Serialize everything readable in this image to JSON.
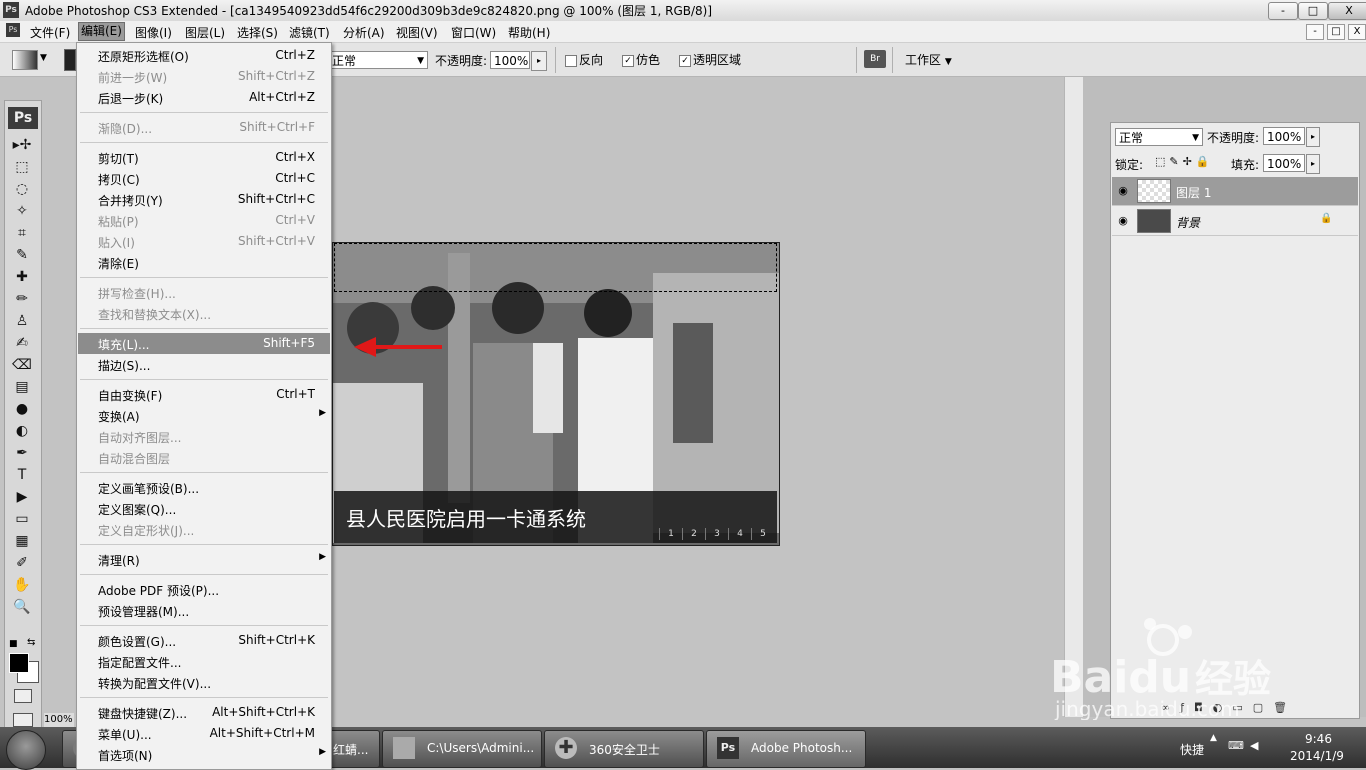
{
  "window": {
    "app_icon": "Ps",
    "title": "Adobe Photoshop CS3 Extended - [ca1349540923dd54f6c29200d309b3de9c824820.png @ 100% (图层 1, RGB/8)]",
    "minimize": "-",
    "maximize": "□",
    "close": "X"
  },
  "menubar": {
    "doc_icon": "Ps",
    "items": [
      "文件(F)",
      "编辑(E)",
      "图像(I)",
      "图层(L)",
      "选择(S)",
      "滤镜(T)",
      "分析(A)",
      "视图(V)",
      "窗口(W)",
      "帮助(H)"
    ],
    "mdi_buttons": [
      "-",
      "□",
      "X"
    ]
  },
  "options": {
    "mode_value": "正常",
    "opacity_label": "不透明度:",
    "opacity_value": "100%",
    "reverse_label": "反向",
    "dither_label": "仿色",
    "transparency_label": "透明区域",
    "workspace_label": "工作区"
  },
  "toolbox": {
    "logo": "Ps",
    "tools": [
      "move-icon",
      "marquee-icon",
      "lasso-icon",
      "magic-wand-icon",
      "crop-icon",
      "slice-icon",
      "healing-icon",
      "brush-icon",
      "stamp-icon",
      "history-brush-icon",
      "eraser-icon",
      "gradient-icon",
      "blur-icon",
      "dodge-icon",
      "pen-icon",
      "type-icon",
      "path-select-icon",
      "shape-icon",
      "notes-icon",
      "eyedropper-icon",
      "hand-icon",
      "zoom-icon"
    ],
    "tool_glyphs": [
      "▸✢",
      "⬚",
      "◌",
      "✧",
      "⌗",
      "✎",
      "✚",
      "✏",
      "♙",
      "✍",
      "⌫",
      "▤",
      "●",
      "◐",
      "✒",
      "T",
      "▶",
      "▭",
      "▦",
      "✐",
      "✋",
      "🔍"
    ]
  },
  "statusbar": {
    "zoom": "100%"
  },
  "edit_menu": {
    "groups": [
      [
        {
          "label": "还原矩形选框(O)",
          "shortcut": "Ctrl+Z",
          "disabled": false
        },
        {
          "label": "前进一步(W)",
          "shortcut": "Shift+Ctrl+Z",
          "disabled": true
        },
        {
          "label": "后退一步(K)",
          "shortcut": "Alt+Ctrl+Z",
          "disabled": false
        }
      ],
      [
        {
          "label": "渐隐(D)...",
          "shortcut": "Shift+Ctrl+F",
          "disabled": true
        }
      ],
      [
        {
          "label": "剪切(T)",
          "shortcut": "Ctrl+X",
          "disabled": false
        },
        {
          "label": "拷贝(C)",
          "shortcut": "Ctrl+C",
          "disabled": false
        },
        {
          "label": "合并拷贝(Y)",
          "shortcut": "Shift+Ctrl+C",
          "disabled": false
        },
        {
          "label": "粘贴(P)",
          "shortcut": "Ctrl+V",
          "disabled": true
        },
        {
          "label": "贴入(I)",
          "shortcut": "Shift+Ctrl+V",
          "disabled": true
        },
        {
          "label": "清除(E)",
          "shortcut": "",
          "disabled": false
        }
      ],
      [
        {
          "label": "拼写检查(H)...",
          "shortcut": "",
          "disabled": true
        },
        {
          "label": "查找和替换文本(X)...",
          "shortcut": "",
          "disabled": true
        }
      ],
      [
        {
          "label": "填充(L)...",
          "shortcut": "Shift+F5",
          "disabled": false,
          "highlighted": true
        },
        {
          "label": "描边(S)...",
          "shortcut": "",
          "disabled": false
        }
      ],
      [
        {
          "label": "自由变换(F)",
          "shortcut": "Ctrl+T",
          "disabled": false
        },
        {
          "label": "变换(A)",
          "shortcut": "",
          "disabled": false,
          "submenu": true
        },
        {
          "label": "自动对齐图层...",
          "shortcut": "",
          "disabled": true
        },
        {
          "label": "自动混合图层",
          "shortcut": "",
          "disabled": true
        }
      ],
      [
        {
          "label": "定义画笔预设(B)...",
          "shortcut": "",
          "disabled": false
        },
        {
          "label": "定义图案(Q)...",
          "shortcut": "",
          "disabled": false
        },
        {
          "label": "定义自定形状(J)...",
          "shortcut": "",
          "disabled": true
        }
      ],
      [
        {
          "label": "清理(R)",
          "shortcut": "",
          "disabled": false,
          "submenu": true
        }
      ],
      [
        {
          "label": "Adobe PDF 预设(P)...",
          "shortcut": "",
          "disabled": false
        },
        {
          "label": "预设管理器(M)...",
          "shortcut": "",
          "disabled": false
        }
      ],
      [
        {
          "label": "颜色设置(G)...",
          "shortcut": "Shift+Ctrl+K",
          "disabled": false
        },
        {
          "label": "指定配置文件...",
          "shortcut": "",
          "disabled": false
        },
        {
          "label": "转换为配置文件(V)...",
          "shortcut": "",
          "disabled": false
        }
      ],
      [
        {
          "label": "键盘快捷键(Z)...",
          "shortcut": "Alt+Shift+Ctrl+K",
          "disabled": false
        },
        {
          "label": "菜单(U)...",
          "shortcut": "Alt+Shift+Ctrl+M",
          "disabled": false
        },
        {
          "label": "首选项(N)",
          "shortcut": "",
          "disabled": false,
          "submenu": true
        }
      ]
    ]
  },
  "document": {
    "caption": "县人民医院启用一卡通系统",
    "pages": [
      "1",
      "2",
      "3",
      "4",
      "5"
    ]
  },
  "layers_panel": {
    "mode_value": "正常",
    "opacity_label": "不透明度:",
    "opacity_value": "100%",
    "lock_label": "锁定:",
    "fill_label": "填充:",
    "fill_value": "100%",
    "layers": [
      {
        "name": "图层 1",
        "selected": true,
        "locked": false
      },
      {
        "name": "背景",
        "selected": false,
        "locked": true
      }
    ],
    "footer_icons": [
      "link-icon",
      "fx-icon",
      "mask-icon",
      "adjustment-icon",
      "group-icon",
      "new-layer-icon",
      "trash-icon"
    ]
  },
  "taskbar": {
    "items": [
      {
        "label": "红蜻...",
        "icon": "ie-icon"
      },
      {
        "label": "C:\\Users\\Admini...",
        "icon": "folder-icon"
      },
      {
        "label": "360安全卫士",
        "icon": "shield-plus-icon"
      },
      {
        "label": "Adobe Photosh...",
        "icon": "photoshop-icon"
      }
    ],
    "quick_launch": "快捷",
    "time": "9:46",
    "date": "2014/1/9"
  },
  "watermark": {
    "brand": "Baidu",
    "suffix": "经验",
    "url": "jingyan.baidu.com"
  },
  "colors": {
    "highlight": "#8c8c8c",
    "arrow": "#e01818"
  }
}
